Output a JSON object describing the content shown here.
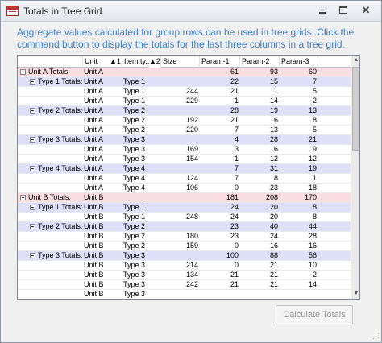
{
  "window": {
    "title": "Totals in Tree Grid",
    "minimize_icon": "minimize-icon",
    "maximize_icon": "maximize-icon",
    "close_icon": "close-icon"
  },
  "description": "Aggregate values calculated for group rows can be used in tree grids. Click the command button to display the totals for the last three columns in a tree grid.",
  "colors": {
    "group_level0": "#f9dde3",
    "group_level1": "#dde0f8",
    "description_text": "#3c7fd0"
  },
  "grid": {
    "columns": {
      "unit": "Unit",
      "unit_sort": "▲1",
      "item_type": "Item ty...",
      "item_type_sort": "▲2",
      "size": "Size",
      "param1": "Param-1",
      "param2": "Param-2",
      "param3": "Param-3"
    },
    "rows": [
      {
        "level": 0,
        "label": "Unit A Totals:",
        "unit": "Unit A",
        "type": "",
        "size": "",
        "p1": "61",
        "p2": "93",
        "p3": "60"
      },
      {
        "level": 1,
        "label": "Type 1 Totals:",
        "unit": "Unit A",
        "type": "Type 1",
        "size": "",
        "p1": "22",
        "p2": "15",
        "p3": "7"
      },
      {
        "level": 2,
        "label": "",
        "unit": "Unit A",
        "type": "Type 1",
        "size": "244",
        "p1": "21",
        "p2": "1",
        "p3": "5"
      },
      {
        "level": 2,
        "label": "",
        "unit": "Unit A",
        "type": "Type 1",
        "size": "229",
        "p1": "1",
        "p2": "14",
        "p3": "2"
      },
      {
        "level": 1,
        "label": "Type 2 Totals:",
        "unit": "Unit A",
        "type": "Type 2",
        "size": "",
        "p1": "28",
        "p2": "19",
        "p3": "13"
      },
      {
        "level": 2,
        "label": "",
        "unit": "Unit A",
        "type": "Type 2",
        "size": "192",
        "p1": "21",
        "p2": "6",
        "p3": "8"
      },
      {
        "level": 2,
        "label": "",
        "unit": "Unit A",
        "type": "Type 2",
        "size": "220",
        "p1": "7",
        "p2": "13",
        "p3": "5"
      },
      {
        "level": 1,
        "label": "Type 3 Totals:",
        "unit": "Unit A",
        "type": "Type 3",
        "size": "",
        "p1": "4",
        "p2": "28",
        "p3": "21"
      },
      {
        "level": 2,
        "label": "",
        "unit": "Unit A",
        "type": "Type 3",
        "size": "169",
        "p1": "3",
        "p2": "16",
        "p3": "9"
      },
      {
        "level": 2,
        "label": "",
        "unit": "Unit A",
        "type": "Type 3",
        "size": "154",
        "p1": "1",
        "p2": "12",
        "p3": "12"
      },
      {
        "level": 1,
        "label": "Type 4 Totals:",
        "unit": "Unit A",
        "type": "Type 4",
        "size": "",
        "p1": "7",
        "p2": "31",
        "p3": "19"
      },
      {
        "level": 2,
        "label": "",
        "unit": "Unit A",
        "type": "Type 4",
        "size": "124",
        "p1": "7",
        "p2": "8",
        "p3": "1"
      },
      {
        "level": 2,
        "label": "",
        "unit": "Unit A",
        "type": "Type 4",
        "size": "106",
        "p1": "0",
        "p2": "23",
        "p3": "18"
      },
      {
        "level": 0,
        "label": "Unit B Totals:",
        "unit": "Unit B",
        "type": "",
        "size": "",
        "p1": "181",
        "p2": "208",
        "p3": "170"
      },
      {
        "level": 1,
        "label": "Type 1 Totals:",
        "unit": "Unit B",
        "type": "Type 1",
        "size": "",
        "p1": "24",
        "p2": "20",
        "p3": "8"
      },
      {
        "level": 2,
        "label": "",
        "unit": "Unit B",
        "type": "Type 1",
        "size": "248",
        "p1": "24",
        "p2": "20",
        "p3": "8"
      },
      {
        "level": 1,
        "label": "Type 2 Totals:",
        "unit": "Unit B",
        "type": "Type 2",
        "size": "",
        "p1": "23",
        "p2": "40",
        "p3": "44"
      },
      {
        "level": 2,
        "label": "",
        "unit": "Unit B",
        "type": "Type 2",
        "size": "180",
        "p1": "23",
        "p2": "24",
        "p3": "28"
      },
      {
        "level": 2,
        "label": "",
        "unit": "Unit B",
        "type": "Type 2",
        "size": "159",
        "p1": "0",
        "p2": "16",
        "p3": "16"
      },
      {
        "level": 1,
        "label": "Type 3 Totals:",
        "unit": "Unit B",
        "type": "Type 3",
        "size": "",
        "p1": "100",
        "p2": "88",
        "p3": "56"
      },
      {
        "level": 2,
        "label": "",
        "unit": "Unit B",
        "type": "Type 3",
        "size": "214",
        "p1": "0",
        "p2": "21",
        "p3": "10"
      },
      {
        "level": 2,
        "label": "",
        "unit": "Unit B",
        "type": "Type 3",
        "size": "134",
        "p1": "21",
        "p2": "21",
        "p3": "2"
      },
      {
        "level": 2,
        "label": "",
        "unit": "Unit B",
        "type": "Type 3",
        "size": "242",
        "p1": "21",
        "p2": "21",
        "p3": "14"
      },
      {
        "level": 2,
        "label": "",
        "unit": "Unit B",
        "type": "Type 3",
        "size": "",
        "p1": "",
        "p2": "",
        "p3": ""
      }
    ]
  },
  "button": {
    "calculate": "Calculate Totals"
  }
}
